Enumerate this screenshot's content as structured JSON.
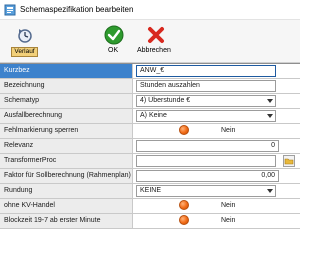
{
  "window": {
    "title": "Schemaspezifikation bearbeiten"
  },
  "toolbar": {
    "verlauf_label": "Verlauf",
    "ok_label": "OK",
    "cancel_label": "Abbrechen"
  },
  "fields": {
    "kurzbez": {
      "label": "Kurzbez",
      "value": "ANW_€"
    },
    "bezeichnung": {
      "label": "Bezeichnung",
      "value": "Stunden auszahlen"
    },
    "schematyp": {
      "label": "Schematyp",
      "value": "4) Überstunde €"
    },
    "ausfallberechnung": {
      "label": "Ausfallberechnung",
      "value": "A)  Keine"
    },
    "fehlmarkierung": {
      "label": "Fehlmarkierung sperren",
      "value": "Nein"
    },
    "relevanz": {
      "label": "Relevanz",
      "value": "0"
    },
    "transformer": {
      "label": "TransformerProc",
      "value": ""
    },
    "faktor": {
      "label": "Faktor für Sollberechnung (Rahmenplan)",
      "value": "0,00"
    },
    "rundung": {
      "label": "Rundung",
      "value": "KEINE"
    },
    "kv_handel": {
      "label": "ohne KV-Handel",
      "value": "Nein"
    },
    "blockzeit": {
      "label": "Blockzeit 19-7 ab erster Minute",
      "value": "Nein"
    }
  },
  "colors": {
    "selected_row": "#3d82cc",
    "toggle": "#f26b16",
    "ok_green": "#2e9a2e",
    "cancel_red": "#d8281e"
  },
  "icons": [
    "app-icon",
    "history-icon",
    "checkmark-icon",
    "cross-icon",
    "radio-toggle-icon",
    "folder-browse-icon",
    "dropdown-arrow-icon"
  ]
}
